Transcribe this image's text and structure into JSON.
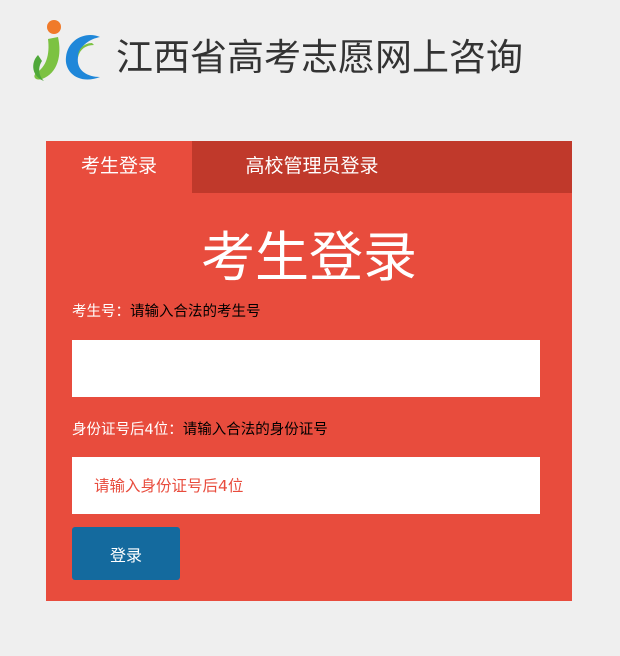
{
  "header": {
    "site_title": "江西省高考志愿网上咨询",
    "logo_icon": "jc-logo-icon"
  },
  "tabs": [
    {
      "label": "考生登录",
      "active": true
    },
    {
      "label": "高校管理员登录",
      "active": false
    }
  ],
  "form": {
    "title": "考生登录",
    "exam_number": {
      "label": "考生号：",
      "hint": "请输入合法的考生号",
      "value": "",
      "placeholder": ""
    },
    "id_number": {
      "label": "身份证号后4位：",
      "hint": "请输入合法的身份证号",
      "value": "",
      "placeholder": "请输入身份证号后4位"
    },
    "login_label": "登录"
  },
  "colors": {
    "background": "#efefef",
    "panel": "#e84c3d",
    "tab_bar": "#c0392b",
    "button": "#146a9e",
    "logo_green": "#7cc242",
    "logo_blue": "#1f87d9",
    "logo_orange": "#f07a2a"
  }
}
